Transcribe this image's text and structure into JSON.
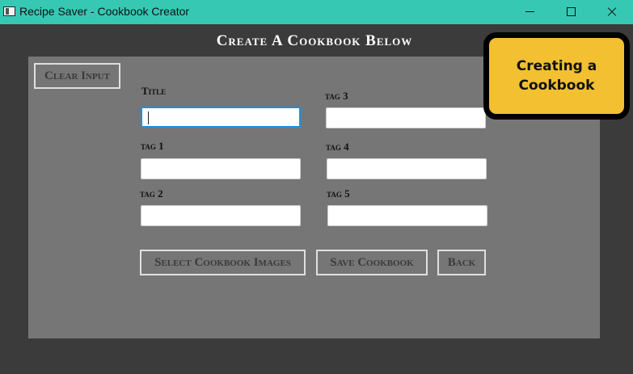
{
  "window": {
    "title": "Recipe Saver - Cookbook Creator"
  },
  "heading": "Create A Cookbook Below",
  "badge": "Creating a Cookbook",
  "buttons": {
    "clear_input": "Clear Input",
    "select_images": "Select Cookbook Images",
    "save": "Save Cookbook",
    "back": "Back"
  },
  "fields": {
    "title": {
      "label": "Title",
      "value": ""
    },
    "tag1": {
      "label": "tag 1",
      "value": ""
    },
    "tag2": {
      "label": "tag 2",
      "value": ""
    },
    "tag3": {
      "label": "tag 3",
      "value": ""
    },
    "tag4": {
      "label": "tag 4",
      "value": ""
    },
    "tag5": {
      "label": "tag 5",
      "value": ""
    }
  },
  "colors": {
    "titlebar": "#37c8b4",
    "badge": "#f2c031",
    "panel": "#777676",
    "background": "#3b3b3b",
    "focus": "#1e90e0"
  }
}
